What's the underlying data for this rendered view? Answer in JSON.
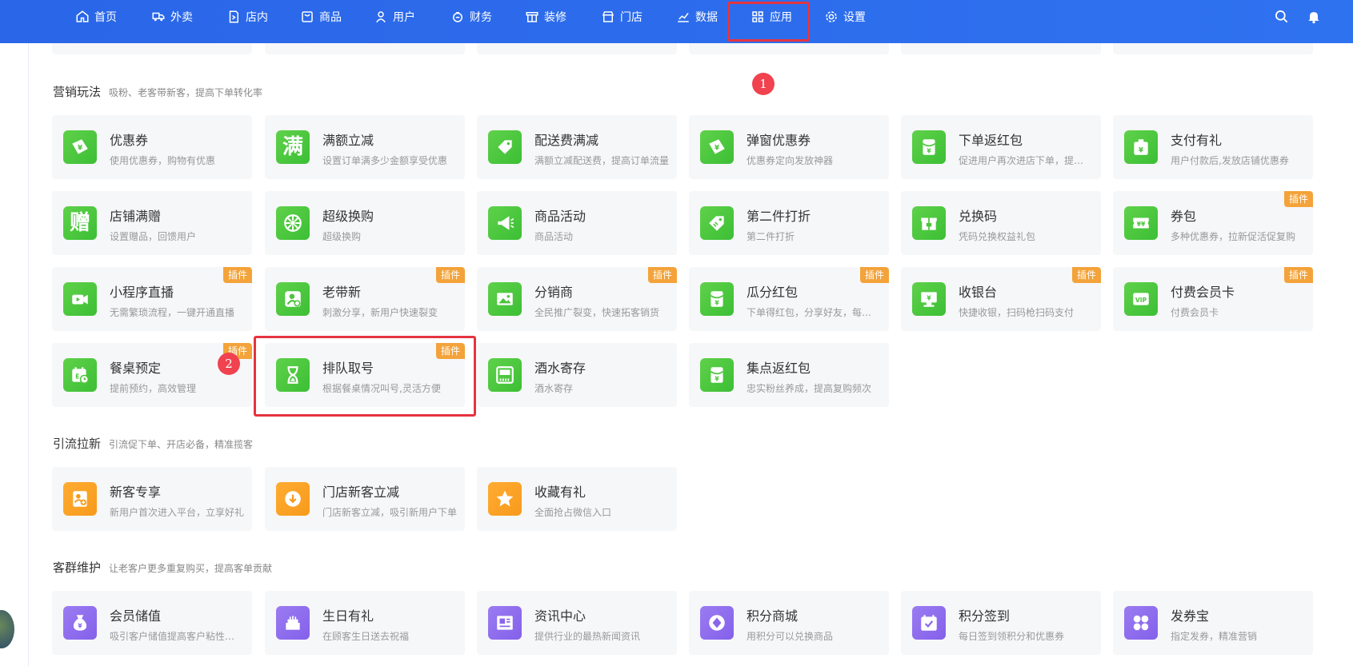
{
  "nav": {
    "items": [
      {
        "label": "首页",
        "icon": "home-icon"
      },
      {
        "label": "外卖",
        "icon": "delivery-icon"
      },
      {
        "label": "店内",
        "icon": "store-in-icon"
      },
      {
        "label": "商品",
        "icon": "goods-icon"
      },
      {
        "label": "用户",
        "icon": "user-icon"
      },
      {
        "label": "财务",
        "icon": "finance-icon"
      },
      {
        "label": "装修",
        "icon": "decor-icon"
      },
      {
        "label": "门店",
        "icon": "shop-icon"
      },
      {
        "label": "数据",
        "icon": "chart-icon"
      },
      {
        "label": "应用",
        "icon": "apps-icon"
      },
      {
        "label": "设置",
        "icon": "gear-icon"
      }
    ],
    "right_icons": [
      "search-icon",
      "bell-icon"
    ]
  },
  "annotations": {
    "step1": "1",
    "step2": "2"
  },
  "sections": [
    {
      "title": "营销玩法",
      "desc": "吸粉、老客带新客，提高下单转化率",
      "cards": [
        {
          "title": "优惠券",
          "desc": "使用优惠券，购物有优惠",
          "color": "green",
          "icon": "coupon-icon"
        },
        {
          "title": "满额立减",
          "desc": "设置订单满多少金额享受优惠",
          "color": "green",
          "icon": "man-glyph-icon",
          "glyph": "满"
        },
        {
          "title": "配送费满减",
          "desc": "满额立减配送费，提高订单流量",
          "color": "green",
          "icon": "tag-icon"
        },
        {
          "title": "弹窗优惠券",
          "desc": "优惠券定向发放神器",
          "color": "green",
          "icon": "coupon-icon"
        },
        {
          "title": "下单返红包",
          "desc": "促进用户再次进店下单，提升复购率",
          "color": "green",
          "icon": "red-envelope-icon"
        },
        {
          "title": "支付有礼",
          "desc": "用户付款后,发放店铺优惠券",
          "color": "green",
          "icon": "gift-envelope-icon"
        },
        {
          "title": "店铺满赠",
          "desc": "设置赠品，回馈用户",
          "color": "green",
          "icon": "zeng-glyph-icon",
          "glyph": "赠"
        },
        {
          "title": "超级换购",
          "desc": "超级换购",
          "color": "green",
          "icon": "wheel-icon"
        },
        {
          "title": "商品活动",
          "desc": "商品活动",
          "color": "green",
          "icon": "megaphone-icon"
        },
        {
          "title": "第二件打折",
          "desc": "第二件打折",
          "color": "green",
          "icon": "price-tag-icon"
        },
        {
          "title": "兑换码",
          "desc": "凭码兑换权益礼包",
          "color": "green",
          "icon": "gift-box-icon"
        },
        {
          "title": "券包",
          "desc": "多种优惠券，拉新促活促复购",
          "color": "green",
          "icon": "ticket-icon",
          "badge": "插件"
        },
        {
          "title": "小程序直播",
          "desc": "无需繁琐流程，一键开通直播",
          "color": "green",
          "icon": "video-icon",
          "badge": "插件"
        },
        {
          "title": "老带新",
          "desc": "刺激分享，新用户快速裂变",
          "color": "green",
          "icon": "user-add-icon",
          "badge": "插件"
        },
        {
          "title": "分销商",
          "desc": "全民推广裂变，快速拓客销货",
          "color": "green",
          "icon": "image-icon",
          "badge": "插件"
        },
        {
          "title": "瓜分红包",
          "desc": "下单得红包，分享好友，每人都能领",
          "color": "green",
          "icon": "red-envelope-icon",
          "badge": "插件"
        },
        {
          "title": "收银台",
          "desc": "快捷收银，扫码枪扫码支付",
          "color": "green",
          "icon": "cashier-icon",
          "badge": "插件"
        },
        {
          "title": "付费会员卡",
          "desc": "付费会员卡",
          "color": "green",
          "icon": "vip-card-icon",
          "badge": "插件"
        },
        {
          "title": "餐桌预定",
          "desc": "提前预约，高效管理",
          "color": "green",
          "icon": "calendar-clock-icon",
          "badge": "插件"
        },
        {
          "title": "排队取号",
          "desc": "根据餐桌情况叫号,灵活方便",
          "color": "green",
          "icon": "hourglass-icon",
          "badge": "插件"
        },
        {
          "title": "酒水寄存",
          "desc": "酒水寄存",
          "color": "green",
          "icon": "storage-icon"
        },
        {
          "title": "集点返红包",
          "desc": "忠实粉丝养成，提高复购频次",
          "color": "green",
          "icon": "red-envelope-icon"
        }
      ]
    },
    {
      "title": "引流拉新",
      "desc": "引流促下单、开店必备，精准揽客",
      "cards": [
        {
          "title": "新客专享",
          "desc": "新用户首次进入平台，立享好礼",
          "color": "orange",
          "icon": "new-user-icon"
        },
        {
          "title": "门店新客立减",
          "desc": "门店新客立减，吸引新用户下单",
          "color": "orange",
          "icon": "badge-down-icon"
        },
        {
          "title": "收藏有礼",
          "desc": "全面抢占微信入口",
          "color": "orange",
          "icon": "star-icon"
        }
      ]
    },
    {
      "title": "客群维护",
      "desc": "让老客户更多重复购买，提高客单贡献",
      "cards": [
        {
          "title": "会员储值",
          "desc": "吸引客户储值提高客户粘性和复购",
          "color": "purple",
          "icon": "money-bag-icon"
        },
        {
          "title": "生日有礼",
          "desc": "在顾客生日送去祝福",
          "color": "purple",
          "icon": "cake-icon"
        },
        {
          "title": "资讯中心",
          "desc": "提供行业的最热新闻资讯",
          "color": "purple",
          "icon": "news-icon"
        },
        {
          "title": "积分商城",
          "desc": "用积分可以兑换商品",
          "color": "purple",
          "icon": "diamond-icon"
        },
        {
          "title": "积分签到",
          "desc": "每日签到领积分和优惠券",
          "color": "purple",
          "icon": "calendar-check-icon"
        },
        {
          "title": "发券宝",
          "desc": "指定发券，精准营销",
          "color": "purple",
          "icon": "apps-grid-icon"
        }
      ]
    }
  ]
}
